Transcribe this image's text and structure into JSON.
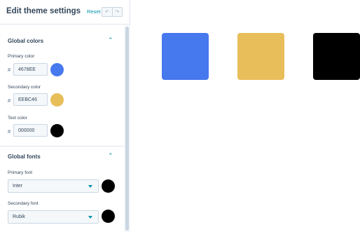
{
  "header": {
    "title": "Edit theme settings",
    "reset_label": "Reset",
    "undo_icon": "undo-icon",
    "redo_icon": "redo-icon"
  },
  "global_colors": {
    "title": "Global colors",
    "primary": {
      "label": "Primary color",
      "hash": "#",
      "value": "4678EE",
      "color": "#4678EE"
    },
    "secondary": {
      "label": "Secondary color",
      "hash": "#",
      "value": "EEBC46",
      "color": "#EEBC46"
    },
    "text": {
      "label": "Text color",
      "hash": "#",
      "value": "000000",
      "color": "#000000"
    }
  },
  "global_fonts": {
    "title": "Global fonts",
    "primary": {
      "label": "Primary font",
      "value": "Inter",
      "color": "#000000"
    },
    "secondary": {
      "label": "Secondary font",
      "value": "Rubik",
      "color": "#000000"
    }
  },
  "preview": {
    "swatches": [
      "#4678EE",
      "#E8BE5A",
      "#000000"
    ]
  },
  "colors": {
    "accent": "#0091ae",
    "text": "#33475b",
    "border": "#cbd6e2"
  }
}
